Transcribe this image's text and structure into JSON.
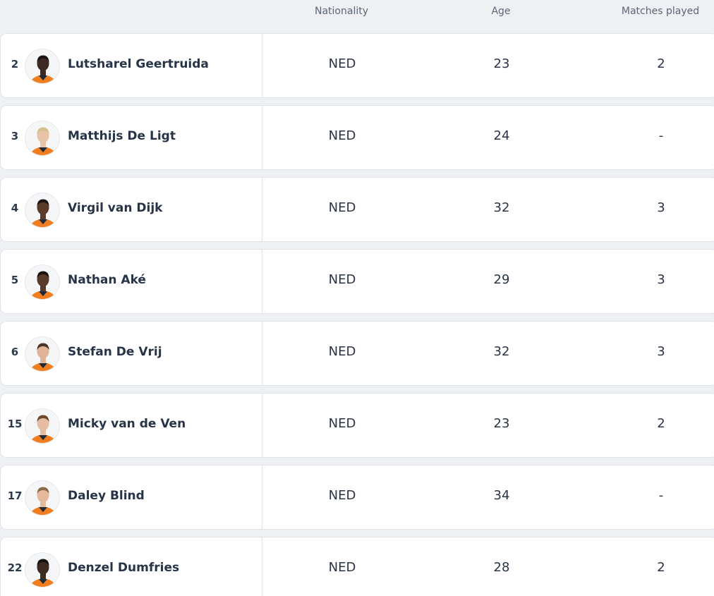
{
  "header": {
    "nationality": "Nationality",
    "age": "Age",
    "matches_played": "Matches played"
  },
  "colors": {
    "shirt_orange": "#f07d1f",
    "row_background": "#ffffff",
    "page_background": "#eef0f4"
  },
  "players": [
    {
      "number": "2",
      "name": "Lutsharel Geertruida",
      "nationality": "NED",
      "age": "23",
      "matches_played": "2",
      "skin": "#3d2a22",
      "hair": "#1a1410"
    },
    {
      "number": "3",
      "name": "Matthijs De Ligt",
      "nationality": "NED",
      "age": "24",
      "matches_played": "-",
      "skin": "#e8c3a8",
      "hair": "#d6c08a"
    },
    {
      "number": "4",
      "name": "Virgil van Dijk",
      "nationality": "NED",
      "age": "32",
      "matches_played": "3",
      "skin": "#5b3b2a",
      "hair": "#1c1410"
    },
    {
      "number": "5",
      "name": "Nathan Aké",
      "nationality": "NED",
      "age": "29",
      "matches_played": "3",
      "skin": "#5a3a28",
      "hair": "#1a120d"
    },
    {
      "number": "6",
      "name": "Stefan De Vrij",
      "nationality": "NED",
      "age": "32",
      "matches_played": "3",
      "skin": "#e0b497",
      "hair": "#4a3324"
    },
    {
      "number": "15",
      "name": "Micky van de Ven",
      "nationality": "NED",
      "age": "23",
      "matches_played": "2",
      "skin": "#e6bda2",
      "hair": "#6b4a30"
    },
    {
      "number": "17",
      "name": "Daley Blind",
      "nationality": "NED",
      "age": "34",
      "matches_played": "-",
      "skin": "#e4b99c",
      "hair": "#8a6a48"
    },
    {
      "number": "22",
      "name": "Denzel Dumfries",
      "nationality": "NED",
      "age": "28",
      "matches_played": "2",
      "skin": "#3e2a20",
      "hair": "#15100c"
    }
  ]
}
